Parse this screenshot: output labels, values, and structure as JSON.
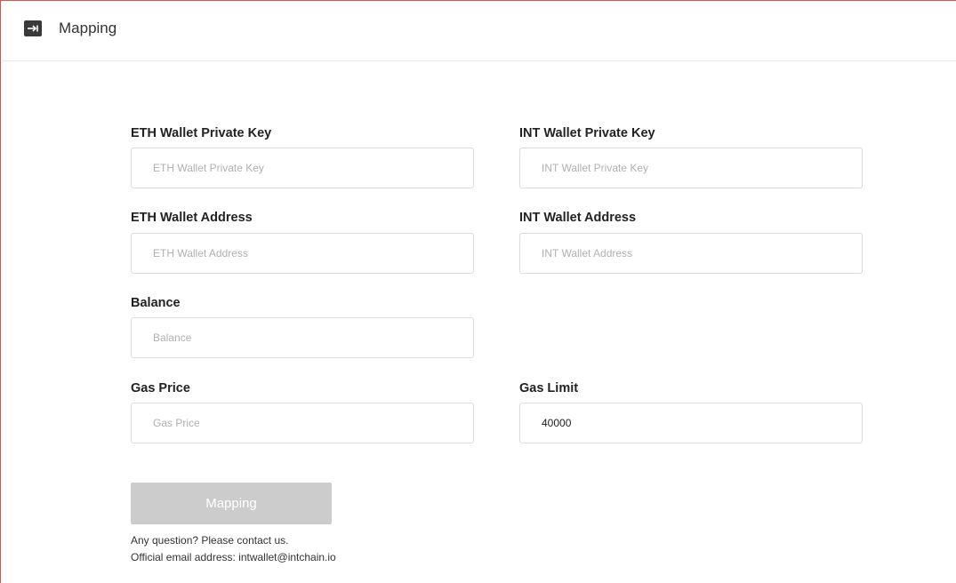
{
  "header": {
    "title": "Mapping",
    "icon": "mapping-arrow-icon"
  },
  "form": {
    "eth_private_key": {
      "label": "ETH Wallet Private Key",
      "placeholder": "ETH Wallet Private Key",
      "value": ""
    },
    "int_private_key": {
      "label": "INT Wallet Private Key",
      "placeholder": "INT Wallet Private Key",
      "value": ""
    },
    "eth_address": {
      "label": "ETH Wallet Address",
      "placeholder": "ETH Wallet Address",
      "value": ""
    },
    "int_address": {
      "label": "INT Wallet Address",
      "placeholder": "INT Wallet Address",
      "value": ""
    },
    "balance": {
      "label": "Balance",
      "placeholder": "Balance",
      "value": ""
    },
    "gas_price": {
      "label": "Gas Price",
      "placeholder": "Gas Price",
      "value": ""
    },
    "gas_limit": {
      "label": "Gas Limit",
      "placeholder": "",
      "value": "40000"
    },
    "submit_label": "Mapping"
  },
  "footer": {
    "contact": "Any question? Please contact us.",
    "email": "Official email address: intwallet@intchain.io"
  },
  "colors": {
    "frame_border": "#d9534f",
    "button_disabled": "#cccccc",
    "input_border": "#dcdcdc"
  }
}
